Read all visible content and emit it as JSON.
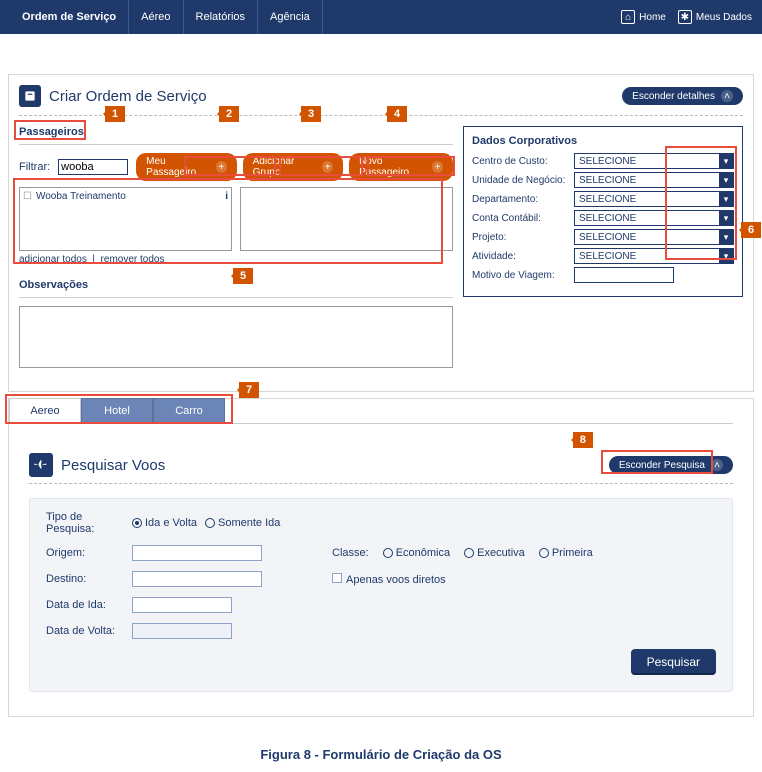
{
  "topnav": {
    "items": [
      "Ordem de Serviço",
      "Aéreo",
      "Relatórios",
      "Agência"
    ],
    "home": "Home",
    "meus_dados": "Meus Dados"
  },
  "header": {
    "title": "Criar Ordem de Serviço",
    "hide_details": "Esconder detalhes"
  },
  "passengers": {
    "section": "Passageiros",
    "filter_label": "Filtrar:",
    "filter_value": "wooba",
    "btn_my": "Meu Passageiro",
    "btn_group": "Adicionar Grupo",
    "btn_new": "Novo Passageiro",
    "list": [
      {
        "name": "Wooba Treinamento",
        "flag": "i"
      }
    ],
    "links": {
      "add_all": "adicionar todos",
      "remove_all": "remover todos"
    }
  },
  "observations": {
    "section": "Observações",
    "value": ""
  },
  "corp": {
    "title": "Dados Corporativos",
    "rows": {
      "centro_custo": {
        "label": "Centro de Custo:",
        "value": "SELECIONE"
      },
      "unidade_negocio": {
        "label": "Unidade de Negócio:",
        "value": "SELECIONE"
      },
      "departamento": {
        "label": "Departamento:",
        "value": "SELECIONE"
      },
      "conta_contabil": {
        "label": "Conta Contábil:",
        "value": "SELECIONE"
      },
      "projeto": {
        "label": "Projeto:",
        "value": "SELECIONE"
      },
      "atividade": {
        "label": "Atividade:",
        "value": "SELECIONE"
      },
      "motivo": {
        "label": "Motivo de Viagem:",
        "value": ""
      }
    }
  },
  "tabs": {
    "items": [
      "Aereo",
      "Hotel",
      "Carro"
    ],
    "active": 0
  },
  "search": {
    "title": "Pesquisar Voos",
    "hide": "Esconder Pesquisa",
    "fields": {
      "tipo_label": "Tipo de Pesquisa:",
      "tipo_options": [
        "Ida e Volta",
        "Somente Ida"
      ],
      "tipo_selected": 0,
      "origem": "Origem:",
      "destino": "Destino:",
      "data_ida": "Data de Ida:",
      "data_volta": "Data de Volta:",
      "classe_label": "Classe:",
      "classe_options": [
        "Econômica",
        "Executiva",
        "Primeira"
      ],
      "diretos": "Apenas voos diretos"
    },
    "submit": "Pesquisar"
  },
  "callouts": [
    "1",
    "2",
    "3",
    "4",
    "5",
    "6",
    "7",
    "8"
  ],
  "caption": "Figura 8 - Formulário de Criação da OS"
}
